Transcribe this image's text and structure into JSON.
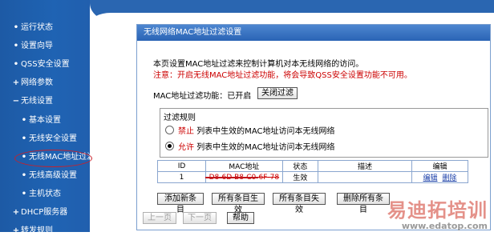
{
  "sidebar": {
    "items": [
      {
        "label": "运行状态",
        "bullet": "•"
      },
      {
        "label": "设置向导",
        "bullet": "•"
      },
      {
        "label": "QSS安全设置",
        "bullet": "•"
      },
      {
        "label": "网络参数",
        "bullet": "+"
      },
      {
        "label": "无线设置",
        "bullet": "−"
      },
      {
        "label": "基本设置",
        "bullet": "•"
      },
      {
        "label": "无线安全设置",
        "bullet": "•"
      },
      {
        "label": "无线MAC地址过滤",
        "bullet": "•"
      },
      {
        "label": "无线高级设置",
        "bullet": "•"
      },
      {
        "label": "主机状态",
        "bullet": "•"
      },
      {
        "label": "DHCP服务器",
        "bullet": "+"
      },
      {
        "label": "转发规则",
        "bullet": "+"
      }
    ]
  },
  "panel": {
    "title": "无线网络MAC地址过滤设置",
    "intro": "本页设置MAC地址过滤来控制计算机对本无线网络的访问。",
    "notice": "注意：开启无线MAC地址过滤功能，将会导致QSS安全设置功能不可用。",
    "status_label": "MAC地址过滤功能：已开启",
    "toggle_button": "关闭过滤",
    "rules": {
      "legend": "过滤规则",
      "deny_keyword": "禁止",
      "deny_text": "列表中生效的MAC地址访问本无线网络",
      "allow_keyword": "允许",
      "allow_text": "列表中生效的MAC地址访问本无线网络",
      "selected": "allow"
    },
    "table": {
      "headers": [
        "ID",
        "MAC地址",
        "状态",
        "描述",
        "编辑"
      ],
      "rows": [
        {
          "id": "1",
          "mac": "D8-6D-B8-C0-6F-78",
          "status": "生效",
          "description": "",
          "edit": "编辑",
          "delete": "删除"
        }
      ]
    },
    "buttons": {
      "add": "添加新条目",
      "enable_all": "所有条目生效",
      "disable_all": "所有条目失效",
      "delete_all": "删除所有条目",
      "prev": "上一页",
      "next": "下一页",
      "help": "帮助"
    }
  },
  "watermark": {
    "logo": "易迪拓培训",
    "url": "www.edatop.com"
  },
  "colors": {
    "sidebar_bg": "#1f63b3",
    "panel_title_bg": "#2a64b5",
    "warning": "#cc0000",
    "annotation": "#c8202a"
  }
}
